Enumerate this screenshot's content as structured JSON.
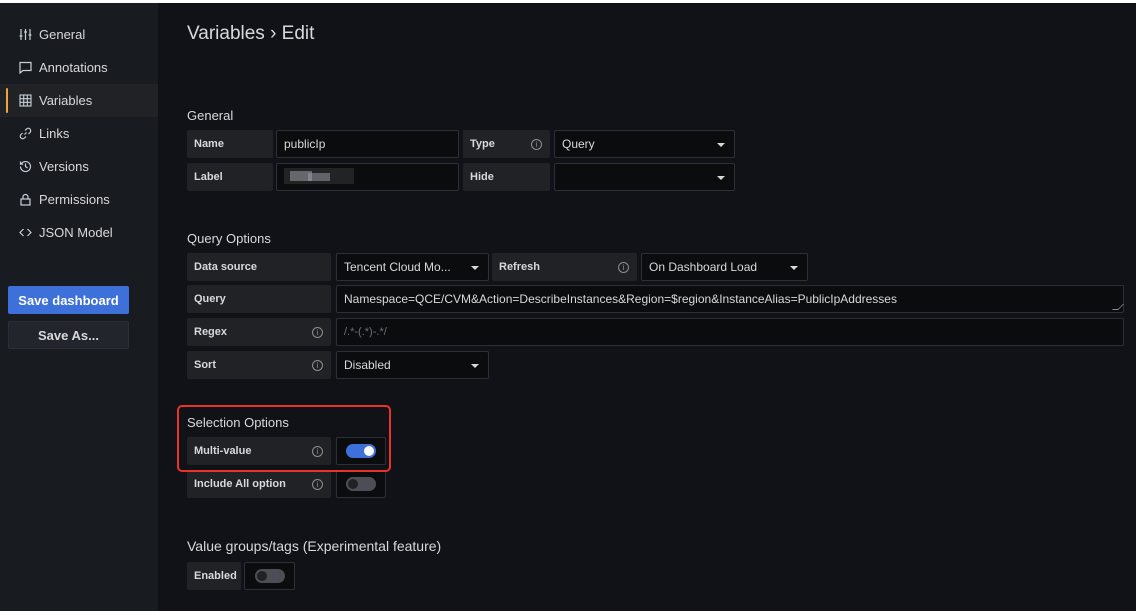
{
  "sidebar": {
    "items": [
      {
        "label": "General",
        "icon": "sliders-icon"
      },
      {
        "label": "Annotations",
        "icon": "comment-icon"
      },
      {
        "label": "Variables",
        "icon": "table-icon"
      },
      {
        "label": "Links",
        "icon": "link-icon"
      },
      {
        "label": "Versions",
        "icon": "history-icon"
      },
      {
        "label": "Permissions",
        "icon": "lock-icon"
      },
      {
        "label": "JSON Model",
        "icon": "code-icon"
      }
    ],
    "active_item": "Variables",
    "save_dashboard_label": "Save dashboard",
    "save_as_label": "Save As..."
  },
  "page": {
    "title": "Variables › Edit"
  },
  "general": {
    "title": "General",
    "name_label": "Name",
    "name_value": "publicIp",
    "type_label": "Type",
    "type_value": "Query",
    "label_label": "Label",
    "label_value": "",
    "hide_label": "Hide",
    "hide_value": ""
  },
  "query_options": {
    "title": "Query Options",
    "datasource_label": "Data source",
    "datasource_value": "Tencent Cloud Mo...",
    "refresh_label": "Refresh",
    "refresh_value": "On Dashboard Load",
    "query_label": "Query",
    "query_value": "Namespace=QCE/CVM&Action=DescribeInstances&Region=$region&InstanceAlias=PublicIpAddresses",
    "regex_label": "Regex",
    "regex_placeholder": "/.*-(.*)-.*/",
    "sort_label": "Sort",
    "sort_value": "Disabled"
  },
  "selection_options": {
    "title": "Selection Options",
    "multi_value_label": "Multi-value",
    "multi_value_on": true,
    "include_all_label": "Include All option",
    "include_all_on": false
  },
  "value_groups": {
    "title": "Value groups/tags (Experimental feature)",
    "enabled_label": "Enabled",
    "enabled_on": false
  },
  "colors": {
    "accent": "#3d71d9",
    "highlight": "#e8332a",
    "active_indicator": "#f2a33a"
  }
}
